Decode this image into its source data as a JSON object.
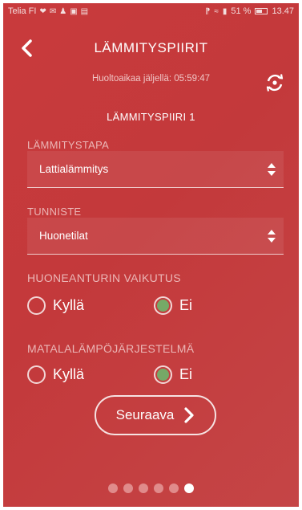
{
  "status_bar": {
    "carrier": "Telia FI",
    "icons": [
      "heart-icon",
      "mail-icon",
      "person-icon",
      "facebook-icon",
      "gallery-icon"
    ],
    "right_icons": [
      "bluetooth-icon",
      "wifi-icon",
      "signal-icon"
    ],
    "battery": "51 %",
    "time": "13.47"
  },
  "header": {
    "title": "LÄMMITYSPIIRIT",
    "service_time": "Huoltoaikaa jäljellä: 05:59:47",
    "sync_icon": "sync-icon"
  },
  "circuit_title": "LÄMMITYSPIIRI 1",
  "fields": {
    "heating_method": {
      "label": "LÄMMITYSTAPA",
      "value": "Lattialämmitys"
    },
    "identifier": {
      "label": "TUNNISTE",
      "value": "Huonetilat"
    }
  },
  "room_sensor": {
    "label": "HUONEANTURIN VAIKUTUS",
    "options": [
      {
        "label": "Kyllä",
        "checked": false
      },
      {
        "label": "Ei",
        "checked": true
      }
    ]
  },
  "low_temp": {
    "label": "MATALALÄMPÖJÄRJESTELMÄ",
    "options": [
      {
        "label": "Kyllä",
        "checked": false
      },
      {
        "label": "Ei",
        "checked": true
      }
    ]
  },
  "next_button": {
    "label": "Seuraava"
  },
  "pager": {
    "total": 6,
    "active": 6
  },
  "colors": {
    "background": "#c93a3c",
    "radio_checked": "#76a967",
    "dot_inactive": "#e08b8b"
  }
}
